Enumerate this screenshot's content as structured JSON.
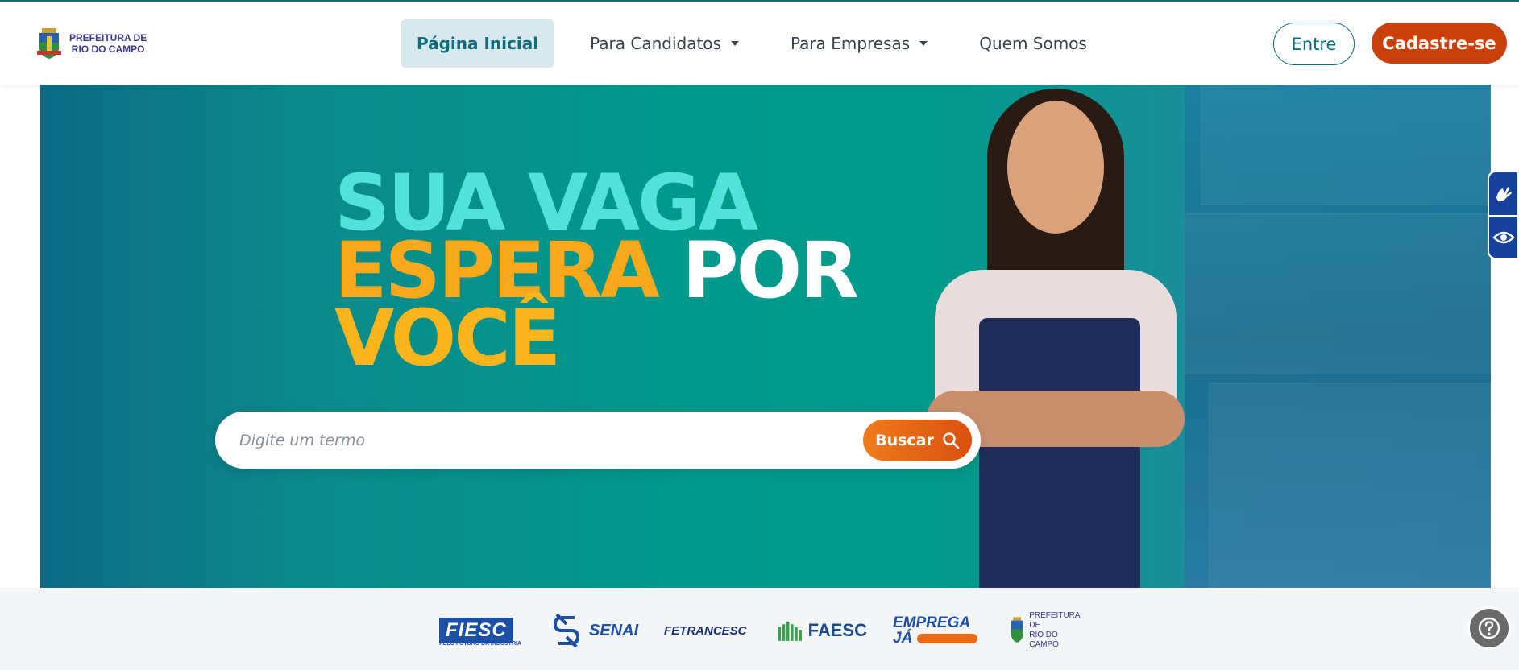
{
  "header": {
    "logo_line1": "PREFEITURA DE",
    "logo_line2": "RIO DO CAMPO",
    "nav": [
      {
        "label": "Página Inicial",
        "active": true
      },
      {
        "label": "Para Candidatos",
        "dropdown": true
      },
      {
        "label": "Para Empresas",
        "dropdown": true
      },
      {
        "label": "Quem Somos"
      }
    ],
    "login_label": "Entre",
    "signup_label": "Cadastre-se"
  },
  "hero": {
    "line1": "SUA VAGA",
    "line2a": "ESPERA",
    "line2b": "POR",
    "line3": "VOCÊ",
    "search_placeholder": "Digite um termo",
    "search_button": "Buscar"
  },
  "partners": {
    "fiesc": "FIESC",
    "fiesc_sub": "PELO FUTURO DA INDÚSTRIA",
    "senai": "SENAI",
    "fetrancesc": "FETRANCESC",
    "faesc": "FAESC",
    "emprega_line1": "EMPREGA",
    "emprega_line2": "JÁ",
    "pref_line1": "PREFEITURA DE",
    "pref_line2": "RIO DO CAMPO"
  },
  "colors": {
    "primary": "#0d6d7c",
    "accent": "#c9400d",
    "hero_teal": "#009a8c",
    "a11y_blue": "#17419b"
  },
  "icons": {
    "a11y_1": "sign-language-hands-icon",
    "a11y_2": "eye-icon",
    "help": "question-mark-icon",
    "search": "search-icon"
  }
}
